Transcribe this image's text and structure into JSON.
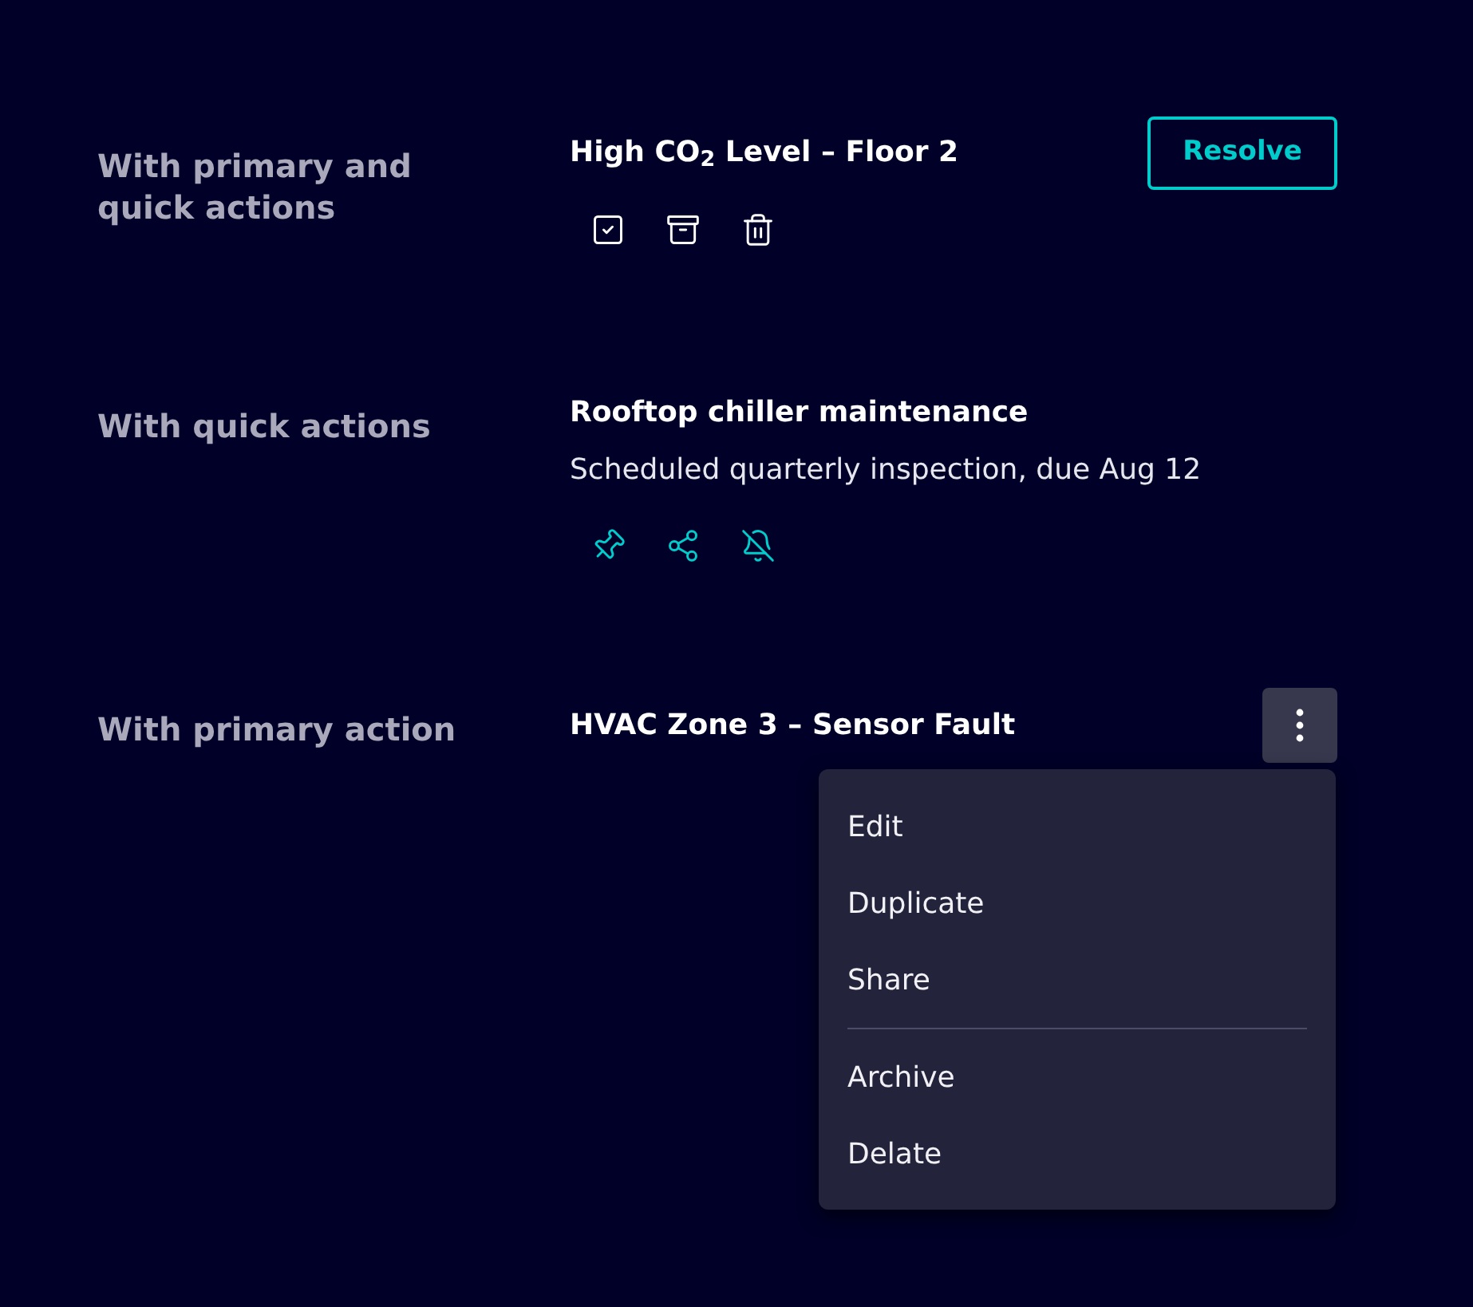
{
  "sections": [
    {
      "kind": "primary_and_quick",
      "label": "With primary and quick actions",
      "title": "High CO$_{2}$ Level – Floor 2",
      "primary_action": {
        "label": "Resolve"
      }
    },
    {
      "kind": "quick",
      "label": "With quick actions",
      "title": "Rooftop chiller maintenance",
      "subtitle": "Scheduled quarterly inspection, due Aug 12"
    },
    {
      "kind": "primary",
      "label": "With primary action",
      "title": "HVAC Zone 3 – Sensor Fault",
      "menu": {
        "expanded": true,
        "groups": [
          [
            "Edit",
            "Duplicate",
            "Share"
          ],
          [
            "Archive",
            "Delate"
          ]
        ]
      }
    }
  ]
}
